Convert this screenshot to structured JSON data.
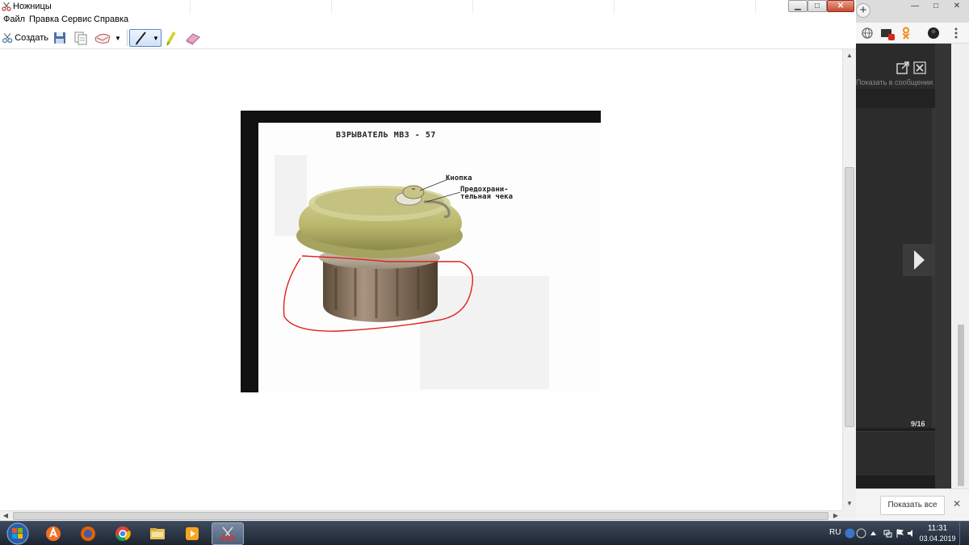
{
  "window": {
    "title": "Ножницы",
    "controls": {
      "minimize": "▁",
      "maximize": "□",
      "close": "✕"
    }
  },
  "menu": [
    {
      "label": "Файл"
    },
    {
      "label": "Правка"
    },
    {
      "label": "Сервис"
    },
    {
      "label": "Справка"
    }
  ],
  "toolbar": {
    "create_label": "Создать",
    "icons": [
      "scissors-icon",
      "save-icon",
      "copy-icon",
      "send-icon",
      "pen-icon",
      "highlighter-icon",
      "eraser-icon"
    ]
  },
  "snip": {
    "title": "ВЗРЫВАТЕЛЬ  МВЗ - 57",
    "callout_button": "Кнопка",
    "callout_pin_line1": "Предохрани-",
    "callout_pin_line2": "тельная чека",
    "annotation_color": "#e0201c"
  },
  "browser": {
    "new_tab": "+",
    "controls": {
      "minimize": "—",
      "maximize": "□",
      "close": "✕"
    },
    "viewer": {
      "show_in_message": "Показать в сообщении",
      "counter": "9/16"
    },
    "download_bar": {
      "show_all": "Показать все",
      "close": "✕"
    }
  },
  "taskbar": {
    "apps": [
      "windows-start-icon",
      "avast-icon",
      "firefox-icon",
      "chrome-icon",
      "file-explorer-icon",
      "media-player-icon",
      "snipping-tool-icon"
    ],
    "active_app": "snipping-tool-icon",
    "tray": {
      "language": "RU"
    },
    "clock": {
      "time": "11:31",
      "date": "03.04.2019"
    }
  },
  "colors": {
    "taskbar": "#2a3546",
    "active_tool": "#cfe1f7",
    "viewer_background": "#1e1e1e",
    "fuse_body": "#bfbd76",
    "fuse_base": "#7e6e58"
  }
}
